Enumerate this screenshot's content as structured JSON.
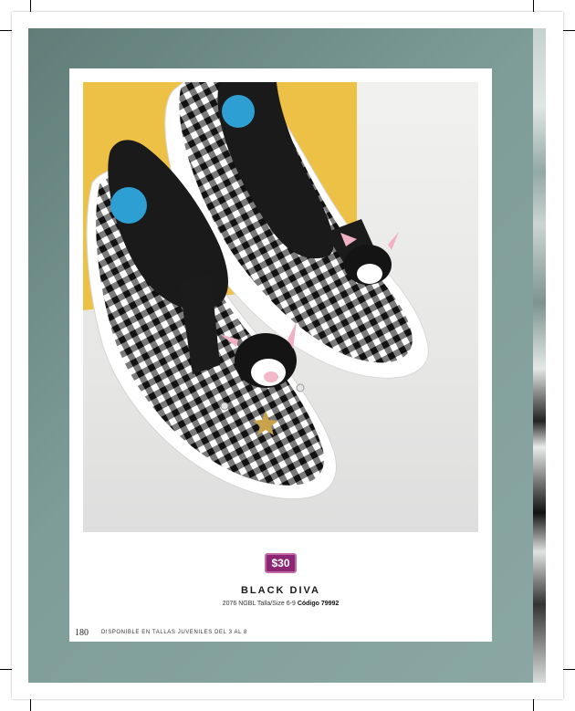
{
  "product": {
    "price": "$30",
    "name": "BLACK DIVA",
    "style_number": "2076 NGBL",
    "size_label": "Talla/Size 6-9",
    "code_label": "Código 79992"
  },
  "footer": {
    "page_number": "180",
    "availability": "DISPONIBLE EN TALLAS JUVENILES DEL 3 AL 8"
  },
  "colors": {
    "band": "#7a9894",
    "price_badge": "#8c2673",
    "backdrop_yellow": "#e9b93c"
  }
}
